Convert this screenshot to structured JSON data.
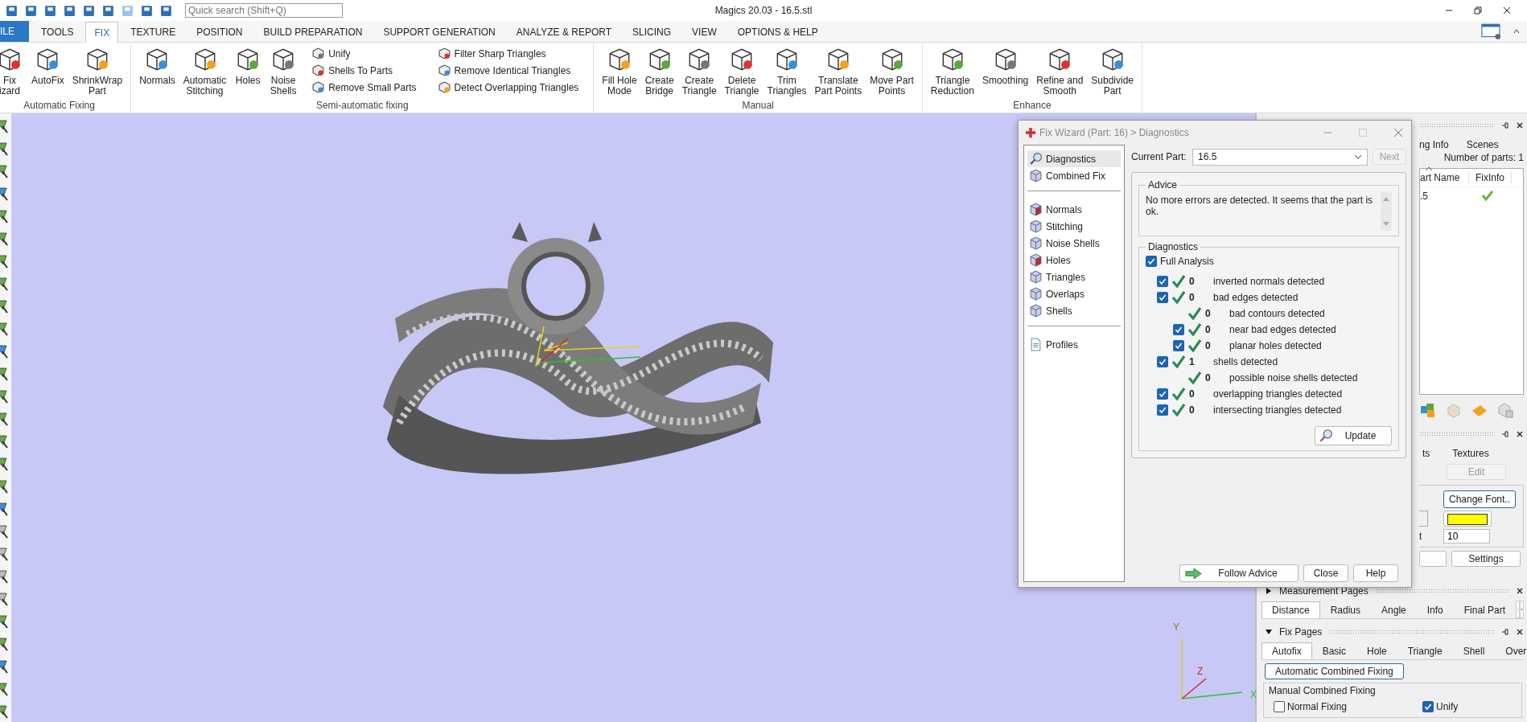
{
  "title_bar": {
    "title": "Magics 20.03 - 16.5.stl",
    "search": {
      "placeholder": "Quick search (Shift+Q)"
    }
  },
  "ribbon_tabs": [
    {
      "label": "ILE",
      "kind": "app"
    },
    {
      "label": "TOOLS",
      "kind": "tab",
      "selected": false
    },
    {
      "label": "FIX",
      "kind": "tab",
      "selected": true
    },
    {
      "label": "TEXTURE",
      "kind": "tab",
      "selected": false
    },
    {
      "label": "POSITION",
      "kind": "tab",
      "selected": false
    },
    {
      "label": "BUILD PREPARATION",
      "kind": "tab",
      "selected": false
    },
    {
      "label": "SUPPORT GENERATION",
      "kind": "tab",
      "selected": false
    },
    {
      "label": "ANALYZE & REPORT",
      "kind": "tab",
      "selected": false
    },
    {
      "label": "SLICING",
      "kind": "tab",
      "selected": false
    },
    {
      "label": "VIEW",
      "kind": "tab",
      "selected": false
    },
    {
      "label": "OPTIONS & HELP",
      "kind": "tab",
      "selected": false
    }
  ],
  "ribbon_groups": [
    {
      "label": "Automatic Fixing",
      "items": [
        {
          "kind": "large",
          "lines": [
            "Fix",
            "izard"
          ]
        },
        {
          "kind": "large",
          "lines": [
            "AutoFix"
          ]
        },
        {
          "kind": "large",
          "lines": [
            "ShrinkWrap",
            "Part"
          ]
        }
      ]
    },
    {
      "label": "Semi-automatic fixing",
      "items": [
        {
          "kind": "large",
          "lines": [
            "Normals"
          ]
        },
        {
          "kind": "large",
          "lines": [
            "Automatic",
            "Stitching"
          ]
        },
        {
          "kind": "large",
          "lines": [
            "Holes"
          ]
        },
        {
          "kind": "large",
          "lines": [
            "Noise",
            "Shells"
          ]
        },
        {
          "kind": "stack",
          "entries": [
            "Unify",
            "Shells To Parts",
            "Remove Small Parts"
          ]
        },
        {
          "kind": "stack",
          "entries": [
            "Filter Sharp Triangles",
            "Remove Identical Triangles",
            "Detect Overlapping Triangles"
          ]
        }
      ]
    },
    {
      "label": "Manual",
      "items": [
        {
          "kind": "large",
          "lines": [
            "Fill Hole",
            "Mode"
          ]
        },
        {
          "kind": "large",
          "lines": [
            "Create",
            "Bridge"
          ]
        },
        {
          "kind": "large",
          "lines": [
            "Create",
            "Triangle"
          ]
        },
        {
          "kind": "large",
          "lines": [
            "Delete",
            "Triangle"
          ]
        },
        {
          "kind": "large",
          "lines": [
            "Trim",
            "Triangles"
          ]
        },
        {
          "kind": "large",
          "lines": [
            "Translate",
            "Part Points"
          ]
        },
        {
          "kind": "large",
          "lines": [
            "Move Part",
            "Points"
          ]
        }
      ]
    },
    {
      "label": "Enhance",
      "items": [
        {
          "kind": "large",
          "lines": [
            "Triangle",
            "Reduction"
          ]
        },
        {
          "kind": "large",
          "lines": [
            "Smoothing"
          ]
        },
        {
          "kind": "large",
          "lines": [
            "Refine and",
            "Smooth"
          ]
        },
        {
          "kind": "large",
          "lines": [
            "Subdivide",
            "Part"
          ]
        }
      ]
    }
  ],
  "fix_wizard": {
    "title": "Fix Wizard (Part: 16) > Diagnostics",
    "nav_groups": [
      {
        "items": [
          {
            "label": "Diagnostics",
            "selected": true
          },
          {
            "label": "Combined Fix",
            "selected": false
          }
        ]
      },
      {
        "items": [
          {
            "label": "Normals",
            "selected": false
          },
          {
            "label": "Stitching",
            "selected": false
          },
          {
            "label": "Noise Shells",
            "selected": false
          },
          {
            "label": "Holes",
            "selected": false
          },
          {
            "label": "Triangles",
            "selected": false
          },
          {
            "label": "Overlaps",
            "selected": false
          },
          {
            "label": "Shells",
            "selected": false
          }
        ]
      },
      {
        "items": [
          {
            "label": "Profiles",
            "selected": false
          }
        ]
      }
    ],
    "current_part": {
      "label": "Current Part:",
      "value": "16.5"
    },
    "next_button": {
      "label": "Next",
      "disabled": true
    },
    "advice": {
      "title": "Advice",
      "text": "No more errors are detected. It seems that the part is ok."
    },
    "diagnostics": {
      "title": "Diagnostics",
      "full_analysis": {
        "label": "Full Analysis",
        "checked": true
      },
      "rows": [
        {
          "kind": "check",
          "checked": true,
          "ok": true,
          "count": "0",
          "label": "inverted normals detected"
        },
        {
          "kind": "check",
          "checked": true,
          "ok": true,
          "count": "0",
          "label": "bad edges detected",
          "children": [
            {
              "kind": "info",
              "ok": true,
              "count": "0",
              "label": "bad contours detected"
            },
            {
              "kind": "check",
              "checked": true,
              "ok": true,
              "count": "0",
              "label": "near bad edges detected"
            },
            {
              "kind": "check",
              "checked": true,
              "ok": true,
              "count": "0",
              "label": "planar holes detected"
            }
          ]
        },
        {
          "kind": "check",
          "checked": true,
          "ok": true,
          "count": "1",
          "label": "shells detected",
          "children": [
            {
              "kind": "info",
              "ok": true,
              "count": "0",
              "label": "possible noise shells detected"
            }
          ]
        },
        {
          "kind": "check",
          "checked": true,
          "ok": true,
          "count": "0",
          "label": "overlapping triangles detected"
        },
        {
          "kind": "check",
          "checked": true,
          "ok": true,
          "count": "0",
          "label": "intersecting triangles detected"
        }
      ]
    },
    "update_button": "Update",
    "buttons": [
      "Follow Advice",
      "Close",
      "Help"
    ]
  },
  "parts_panel": {
    "tabs": [
      "ng Info",
      "Scenes"
    ],
    "part_count": "Number of parts: 1",
    "columns": [
      "art Name",
      "FixInfo"
    ],
    "rows": [
      {
        "name": ".5",
        "fix_ok": true
      }
    ]
  },
  "label_panel": {
    "tabs": [
      "ts",
      "Textures"
    ],
    "edit_button": {
      "label": "Edit",
      "disabled": true
    },
    "change_font": "Change Font..",
    "size_label": "t",
    "size_value": "10",
    "settings_button": "Settings"
  },
  "measurement_pages": {
    "title": "Measurement Pages",
    "expanded": false,
    "tabs": [
      {
        "label": "Distance",
        "selected": true
      },
      {
        "label": "Radius",
        "selected": false
      },
      {
        "label": "Angle",
        "selected": false
      },
      {
        "label": "Info",
        "selected": false
      },
      {
        "label": "Final Part",
        "selected": false
      }
    ]
  },
  "fix_pages": {
    "title": "Fix Pages",
    "expanded": true,
    "tabs": [
      {
        "label": "Autofix",
        "selected": true
      },
      {
        "label": "Basic",
        "selected": false
      },
      {
        "label": "Hole",
        "selected": false
      },
      {
        "label": "Triangle",
        "selected": false
      },
      {
        "label": "Shell",
        "selected": false
      },
      {
        "label": "Over",
        "selected": false
      }
    ],
    "auto_button": "Automatic Combined Fixing",
    "manual_group": {
      "title": "Manual Combined Fixing",
      "options": [
        {
          "label": "Normal Fixing",
          "checked": false
        },
        {
          "label": "Unify",
          "checked": true
        }
      ]
    }
  },
  "axes": [
    "Y",
    "Z",
    "X"
  ]
}
